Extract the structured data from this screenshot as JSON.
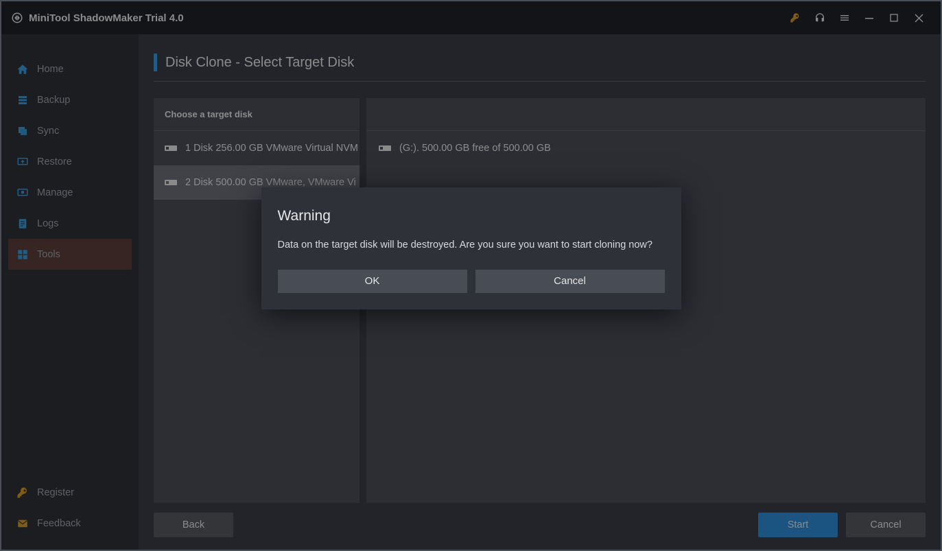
{
  "app": {
    "title": "MiniTool ShadowMaker Trial 4.0"
  },
  "sidebar": {
    "items": [
      {
        "label": "Home",
        "icon": "home-icon"
      },
      {
        "label": "Backup",
        "icon": "backup-icon"
      },
      {
        "label": "Sync",
        "icon": "sync-icon"
      },
      {
        "label": "Restore",
        "icon": "restore-icon"
      },
      {
        "label": "Manage",
        "icon": "manage-icon"
      },
      {
        "label": "Logs",
        "icon": "logs-icon"
      },
      {
        "label": "Tools",
        "icon": "tools-icon"
      }
    ],
    "active_index": 6,
    "bottom": [
      {
        "label": "Register",
        "icon": "key-icon"
      },
      {
        "label": "Feedback",
        "icon": "mail-icon"
      }
    ]
  },
  "page": {
    "title": "Disk Clone - Select Target Disk",
    "left_header": "Choose a target disk",
    "disks": [
      {
        "label": "1 Disk 256.00 GB VMware Virtual NVM",
        "selected": false
      },
      {
        "label": "2 Disk 500.00 GB VMware,  VMware Vi",
        "selected": true
      }
    ],
    "partitions": [
      {
        "label": "(G:).  500.00 GB free of 500.00 GB"
      }
    ],
    "footer": {
      "back": "Back",
      "start": "Start",
      "cancel": "Cancel"
    }
  },
  "dialog": {
    "title": "Warning",
    "message": "Data on the target disk will be destroyed. Are you sure you want to start cloning now?",
    "ok": "OK",
    "cancel": "Cancel"
  }
}
